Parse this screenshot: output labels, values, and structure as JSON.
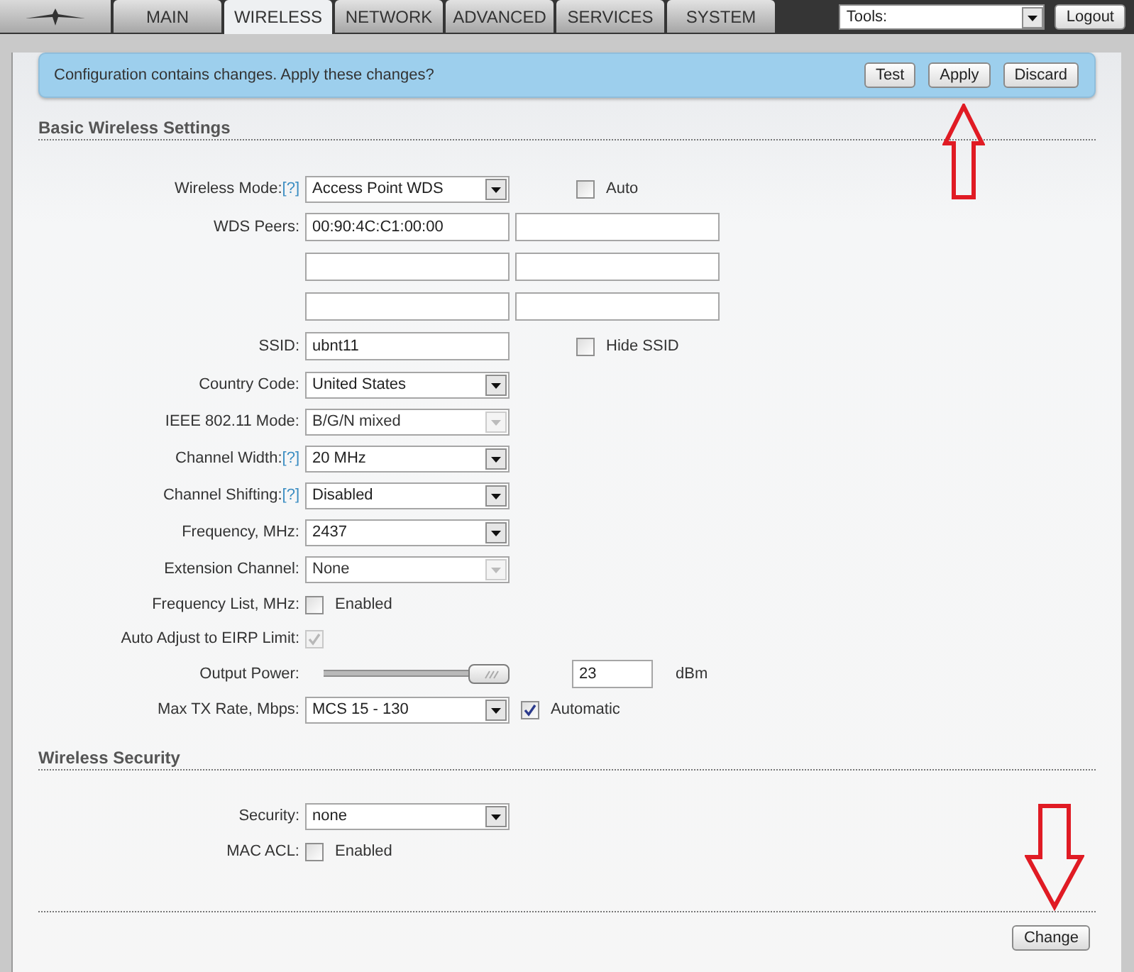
{
  "nav": {
    "tabs": [
      {
        "label": "MAIN",
        "selected": false
      },
      {
        "label": "WIRELESS",
        "selected": true
      },
      {
        "label": "NETWORK",
        "selected": false
      },
      {
        "label": "ADVANCED",
        "selected": false
      },
      {
        "label": "SERVICES",
        "selected": false
      },
      {
        "label": "SYSTEM",
        "selected": false
      }
    ],
    "tools": "Tools:",
    "logout": "Logout"
  },
  "alert": {
    "message": "Configuration contains changes. Apply these changes?",
    "buttons": [
      "Test",
      "Apply",
      "Discard"
    ]
  },
  "sections": [
    {
      "title": "Basic Wireless Settings",
      "rows": [
        {
          "label": "Wireless Mode:",
          "help": "[?]",
          "controls": [
            {
              "kind": "select",
              "value": "Access Point WDS",
              "disabled": false
            }
          ],
          "aside": [
            {
              "kind": "checkbox",
              "label": "Auto",
              "checked": false,
              "disabled": false
            }
          ]
        },
        {
          "label": "WDS Peers:",
          "controls": [
            {
              "kind": "text",
              "value": "00:90:4C:C1:00:00"
            },
            {
              "kind": "text"
            }
          ]
        },
        {
          "controls": [
            {
              "kind": "text"
            },
            {
              "kind": "text"
            }
          ]
        },
        {
          "controls": [
            {
              "kind": "text"
            },
            {
              "kind": "text"
            }
          ]
        },
        {
          "label": "SSID:",
          "controls": [
            {
              "kind": "text",
              "value": "ubnt11"
            }
          ],
          "aside": [
            {
              "kind": "checkbox",
              "label": "Hide SSID",
              "checked": false,
              "disabled": false
            }
          ]
        },
        {
          "label": "Country Code:",
          "controls": [
            {
              "kind": "select",
              "value": "United States",
              "disabled": false
            }
          ]
        },
        {
          "label": "IEEE 802.11 Mode:",
          "controls": [
            {
              "kind": "select",
              "value": "B/G/N mixed",
              "disabled": true
            }
          ]
        },
        {
          "label": "Channel Width:",
          "help": "[?]",
          "controls": [
            {
              "kind": "select",
              "value": "20 MHz",
              "disabled": false
            }
          ]
        },
        {
          "label": "Channel Shifting:",
          "help": "[?]",
          "controls": [
            {
              "kind": "select",
              "value": "Disabled",
              "disabled": false
            }
          ]
        },
        {
          "label": "Frequency, MHz:",
          "controls": [
            {
              "kind": "select",
              "value": "2437",
              "disabled": false
            }
          ]
        },
        {
          "label": "Extension Channel:",
          "controls": [
            {
              "kind": "select",
              "value": "None",
              "disabled": true
            }
          ]
        },
        {
          "label": "Frequency List, MHz:",
          "controls": [
            {
              "kind": "checkbox",
              "label": "Enabled",
              "checked": false,
              "disabled": false
            }
          ]
        },
        {
          "label": "Auto Adjust to EIRP Limit:",
          "controls": [
            {
              "kind": "checkbox",
              "checked": true,
              "disabled": true
            }
          ]
        },
        {
          "label": "Output Power:",
          "controls": [
            {
              "kind": "slider",
              "level": 1
            }
          ],
          "aside": [
            {
              "kind": "text",
              "value": "23"
            },
            {
              "kind": "unit",
              "text": "dBm"
            }
          ]
        },
        {
          "label": "Max TX Rate, Mbps:",
          "controls": [
            {
              "kind": "select",
              "value": "MCS 15 - 130",
              "disabled": false
            },
            {
              "kind": "checkbox",
              "label": "Automatic",
              "checked": true,
              "disabled": false
            }
          ]
        }
      ]
    },
    {
      "title": "Wireless Security",
      "rows": [
        {
          "label": "Security:",
          "controls": [
            {
              "kind": "select",
              "value": "none",
              "disabled": false
            }
          ]
        },
        {
          "label": "MAC ACL:",
          "controls": [
            {
              "kind": "checkbox",
              "label": "Enabled",
              "checked": false,
              "disabled": false
            }
          ]
        }
      ]
    }
  ],
  "footer": {
    "button": "Change"
  }
}
